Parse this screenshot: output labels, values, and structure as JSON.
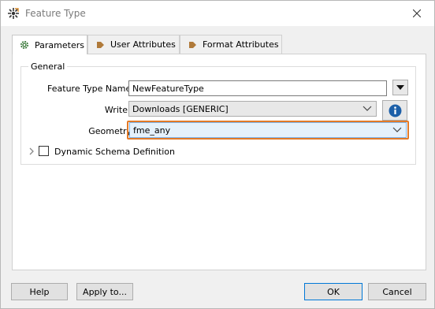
{
  "window": {
    "title": "Feature Type"
  },
  "tabs": [
    {
      "label": "Parameters",
      "icon": "gear-icon"
    },
    {
      "label": "User Attributes",
      "icon": "arrow-right-icon"
    },
    {
      "label": "Format Attributes",
      "icon": "arrow-right-icon"
    }
  ],
  "general": {
    "group_label": "General",
    "feature_type_name_label": "Feature Type Name:",
    "feature_type_name_value": "NewFeatureType",
    "writer_label": "Writer:",
    "writer_value": "Downloads [GENERIC]",
    "geometry_label": "Geometry:",
    "geometry_value": "fme_any",
    "dynamic_schema_label": "Dynamic Schema Definition"
  },
  "buttons": {
    "help": "Help",
    "apply_to": "Apply to...",
    "ok": "OK",
    "cancel": "Cancel"
  },
  "colors": {
    "highlight": "#e27a28",
    "info": "#1c5fa8",
    "tab_arrow": "#b07a3a"
  }
}
